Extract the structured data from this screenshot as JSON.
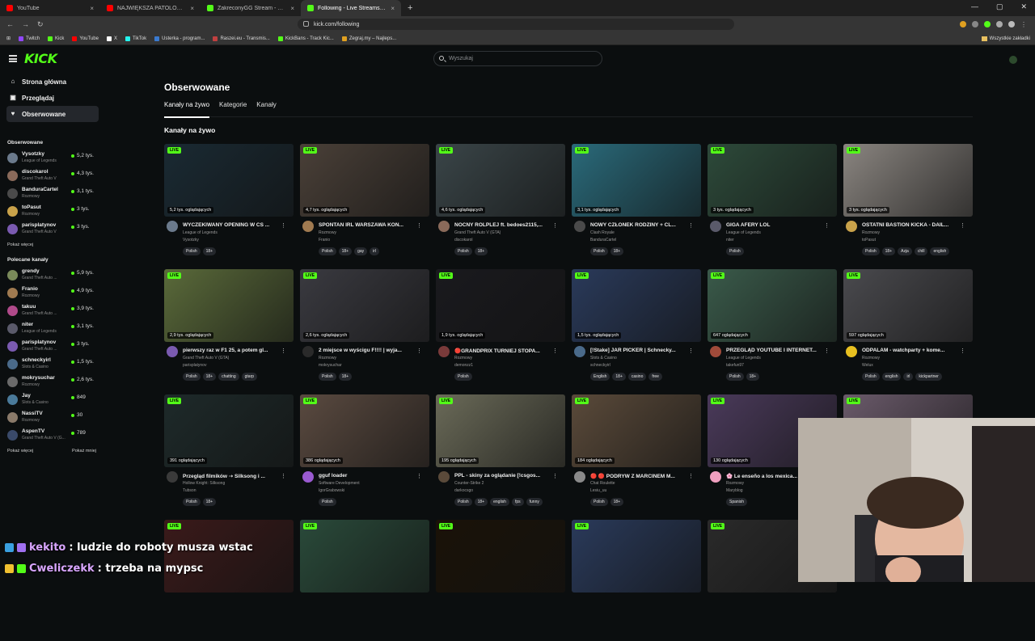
{
  "browser": {
    "tabs": [
      {
        "title": "YouTube",
        "color": "#ff0000",
        "active": false
      },
      {
        "title": "NAJWIĘKSZA PATOLOGIA W POLSCE",
        "color": "#ff0000",
        "active": false
      },
      {
        "title": "ZakreconyGG Stream - Watch Li...",
        "color": "#53fc18",
        "active": false
      },
      {
        "title": "Following - Live Streams on Kick",
        "color": "#53fc18",
        "active": true
      }
    ],
    "new_tab": "+",
    "url": "kick.com/following",
    "bookmarks": [
      "Twitch",
      "Kick",
      "YouTube",
      "X",
      "TikTok",
      "Usterka - program...",
      "Raszei.eu - Transmis...",
      "KickBans - Track Kic...",
      "Zegraj.my – Najleps..."
    ],
    "bookmarks_right": "Wszystkie zakładki"
  },
  "header": {
    "logo": "KICK",
    "search_placeholder": "Wyszukaj"
  },
  "sidebar": {
    "nav": [
      {
        "label": "Strona główna",
        "icon": "⌂"
      },
      {
        "label": "Przeglądaj",
        "icon": "▣"
      },
      {
        "label": "Obserwowane",
        "icon": "♥"
      }
    ],
    "following_heading": "Obserwowane",
    "following": [
      {
        "name": "Vysotzky",
        "game": "League of Legends",
        "viewers": "5,2 tys.",
        "color": "#6b7a8c"
      },
      {
        "name": "discokarol",
        "game": "Grand Theft Auto V",
        "viewers": "4,3 tys.",
        "color": "#8a6a5a"
      },
      {
        "name": "BanduraCartel",
        "game": "Rozmowy",
        "viewers": "3,1 tys.",
        "color": "#4a4a4a"
      },
      {
        "name": "toPasut",
        "game": "Rozmowy",
        "viewers": "3 tys.",
        "color": "#c9a24a"
      },
      {
        "name": "parisplatynov",
        "game": "Grand Theft Auto V",
        "viewers": "3 tys.",
        "color": "#7a5ab0"
      }
    ],
    "show_more": "Pokaż więcej",
    "recommended_heading": "Polecane kanały",
    "recommended": [
      {
        "name": "grendy",
        "game": "Grand Theft Auto ...",
        "viewers": "5,9 tys.",
        "color": "#7a8a5a"
      },
      {
        "name": "Franio",
        "game": "Rozmowy",
        "viewers": "4,9 tys.",
        "color": "#a07a50"
      },
      {
        "name": "takuu",
        "game": "Grand Theft Auto ...",
        "viewers": "3,9 tys.",
        "color": "#b04a8a"
      },
      {
        "name": "niter",
        "game": "League of Legends",
        "viewers": "3,1 tys.",
        "color": "#5a5a6a"
      },
      {
        "name": "parisplatynov",
        "game": "Grand Theft Auto ...",
        "viewers": "3 tys.",
        "color": "#7a5ab0"
      },
      {
        "name": "schneckyirl",
        "game": "Slots & Casino",
        "viewers": "1,5 tys.",
        "color": "#4a6a8a"
      },
      {
        "name": "mokrysuchar",
        "game": "Rozmowy",
        "viewers": "2,6 tys.",
        "color": "#6a6a6a"
      },
      {
        "name": "Jay",
        "game": "Slots & Casino",
        "viewers": "849",
        "color": "#4a7a9a"
      },
      {
        "name": "NassiTV",
        "game": "Rozmowy",
        "viewers": "30",
        "color": "#8a7a6a"
      },
      {
        "name": "AspenTV",
        "game": "Grand Theft Auto V (G...",
        "viewers": "789",
        "color": "#3a4a6a"
      }
    ],
    "show_more2": "Pokaż więcej",
    "show_less": "Pokaż mniej"
  },
  "main": {
    "page_title": "Obserwowane",
    "tabs": [
      "Kanały na żywo",
      "Kategorie",
      "Kanały"
    ],
    "section_title": "Kanały na żywo",
    "live_label": "LIVE",
    "cards": [
      {
        "viewers": "5,2 tys. oglądających",
        "title": "WYCZEKIWANY OPENING W CS ...",
        "game": "League of Legends",
        "user": "Vysotzky",
        "tags": [
          "Polish",
          "18+"
        ],
        "thumb": "#1a2a33",
        "avatar": "#6b7a8c"
      },
      {
        "viewers": "4,7 tys. oglądających",
        "title": "SPONTAN IRL WARSZAWA KON...",
        "game": "Rozmowy",
        "user": "Franio",
        "tags": [
          "Polish",
          "18+",
          "gay",
          "irl"
        ],
        "thumb": "#4a4038",
        "avatar": "#a07a50"
      },
      {
        "viewers": "4,6 tys. oglądających",
        "title": "NOCNY ROLPLEJ ft. bedoes2115,...",
        "game": "Grand Theft Auto V (GTA)",
        "user": "discokarol",
        "tags": [
          "Polish",
          "18+"
        ],
        "thumb": "#3a4548",
        "avatar": "#8a6a5a"
      },
      {
        "viewers": "3,1 tys. oglądających",
        "title": "NOWY CZŁONEK RODZINY + CL...",
        "game": "Clash Royale",
        "user": "BanduraCartel",
        "tags": [
          "Polish",
          "18+"
        ],
        "thumb": "#2a6a7a",
        "avatar": "#4a4a4a"
      },
      {
        "viewers": "3 tys. oglądających",
        "title": "GIGA AFERY LOL",
        "game": "League of Legends",
        "user": "niter",
        "tags": [
          "Polish"
        ],
        "thumb": "#2d4a3a",
        "avatar": "#5a5a6a"
      },
      {
        "viewers": "3 tys. oglądających",
        "title": "OSTATNI BASTION KICKA - DAIL...",
        "game": "Rozmowy",
        "user": "toPasut",
        "tags": [
          "Polish",
          "18+",
          "Azja",
          "chill",
          "english"
        ],
        "thumb": "#8a8580",
        "avatar": "#c9a24a"
      },
      {
        "viewers": "2,9 tys. oglądających",
        "title": "pierwszy raz w F1 25, a potem gl...",
        "game": "Grand Theft Auto V (GTA)",
        "user": "parisplatynov",
        "tags": [
          "Polish",
          "18+",
          "chatting",
          "gtarp"
        ],
        "thumb": "#5a6a3a",
        "avatar": "#7a5ab0"
      },
      {
        "viewers": "2,6 tys. oglądających",
        "title": "2 miejsce w wyścigu F!!!! | wyja...",
        "game": "Rozmowy",
        "user": "mokrysuchar",
        "tags": [
          "Polish",
          "18+"
        ],
        "thumb": "#3a3a40",
        "avatar": "#2a2a2a"
      },
      {
        "viewers": "1,9 tys. oglądających",
        "title": "🔴GRANDPRIX TURNIEJ STOPA...",
        "game": "Rozmowy",
        "user": "demonzz1",
        "tags": [
          "Polish"
        ],
        "thumb": "#1a1a1e",
        "avatar": "#7a3a3a"
      },
      {
        "viewers": "1,5 tys. oglądających",
        "title": "[!Stake] JAR PICKER | Schnecky...",
        "game": "Slots & Casino",
        "user": "schneckyirl",
        "tags": [
          "English",
          "18+",
          "casino",
          "free"
        ],
        "thumb": "#2a3a5a",
        "avatar": "#4a6a8a"
      },
      {
        "viewers": "647 oglądających",
        "title": "PRZEGLĄD YOUTUBE I INTERNET...",
        "game": "League of Legends",
        "user": "takefun97",
        "tags": [
          "Polish",
          "18+"
        ],
        "thumb": "#3a5a4a",
        "avatar": "#a04a3a"
      },
      {
        "viewers": "597 oglądających",
        "title": "ODPALAM - watchparty + kome...",
        "game": "Rozmowy",
        "user": "Welux",
        "tags": [
          "Polish",
          "english",
          "irl",
          "kickpartner"
        ],
        "thumb": "#4a4a4e",
        "avatar": "#e8c020"
      },
      {
        "viewers": "391 oglądających",
        "title": "Przegląd filmików ➝ Silksong i ...",
        "game": "Hollow Knight: Silksong",
        "user": "Tubson",
        "tags": [
          "Polish",
          "18+"
        ],
        "thumb": "#1e2a2a",
        "avatar": "#3a3a3a"
      },
      {
        "viewers": "386 oglądających",
        "title": "gguf loader",
        "game": "Software Development",
        "user": "IgorGrabowski",
        "tags": [
          "Polish"
        ],
        "thumb": "#5a4a40",
        "avatar": "#9a5ad0"
      },
      {
        "viewers": "195 oglądających",
        "title": "PPL - skiny za oglądanie [!csgos...",
        "game": "Counter-Strike 2",
        "user": "darkocsgo",
        "tags": [
          "Polish",
          "18+",
          "english",
          "fps",
          "funny"
        ],
        "thumb": "#6a6a58",
        "avatar": "#5a4a3a"
      },
      {
        "viewers": "184 oglądających",
        "title": "🔴 🔴 PODRYW Z MARCINEM M...",
        "game": "Chat Roulette",
        "user": "Lesiu_uu",
        "tags": [
          "Polish",
          "18+"
        ],
        "thumb": "#5a4a3a",
        "avatar": "#8a8a8a"
      },
      {
        "viewers": "130 oglądających",
        "title": "🌸 Le enseño a los mexica...",
        "game": "Rozmowy",
        "user": "Maryblog",
        "tags": [
          "Spanish"
        ],
        "thumb": "#4a3a5a",
        "avatar": "#f0a0c0"
      },
      {
        "viewers": "",
        "title": "",
        "game": "",
        "user": "",
        "tags": [],
        "thumb": "#6a5a6a",
        "avatar": "#6a5a6a"
      },
      {
        "viewers": "",
        "title": "",
        "game": "",
        "user": "",
        "tags": [],
        "thumb": "#3a1a1a",
        "avatar": "#3a1a1a"
      },
      {
        "viewers": "",
        "title": "",
        "game": "",
        "user": "",
        "tags": [],
        "thumb": "#2a4a3a",
        "avatar": "#2a4a3a"
      },
      {
        "viewers": "",
        "title": "",
        "game": "",
        "user": "",
        "tags": [],
        "thumb": "#1a1208",
        "avatar": "#1a1208"
      },
      {
        "viewers": "",
        "title": "",
        "game": "",
        "user": "",
        "tags": [],
        "thumb": "#2a3a5a",
        "avatar": "#2a3a5a"
      },
      {
        "viewers": "",
        "title": "",
        "game": "",
        "user": "",
        "tags": [],
        "thumb": "#2a2a2a",
        "avatar": "#2a2a2a"
      }
    ]
  },
  "overlay": {
    "chat": [
      {
        "user": "kekito",
        "message": ": ludzie do roboty musza wstac"
      },
      {
        "user": "Cweliczekk",
        "message": ": trzeba na mypsc"
      }
    ]
  },
  "colors": {
    "accent": "#53fc18",
    "background": "#0b0e0f"
  }
}
